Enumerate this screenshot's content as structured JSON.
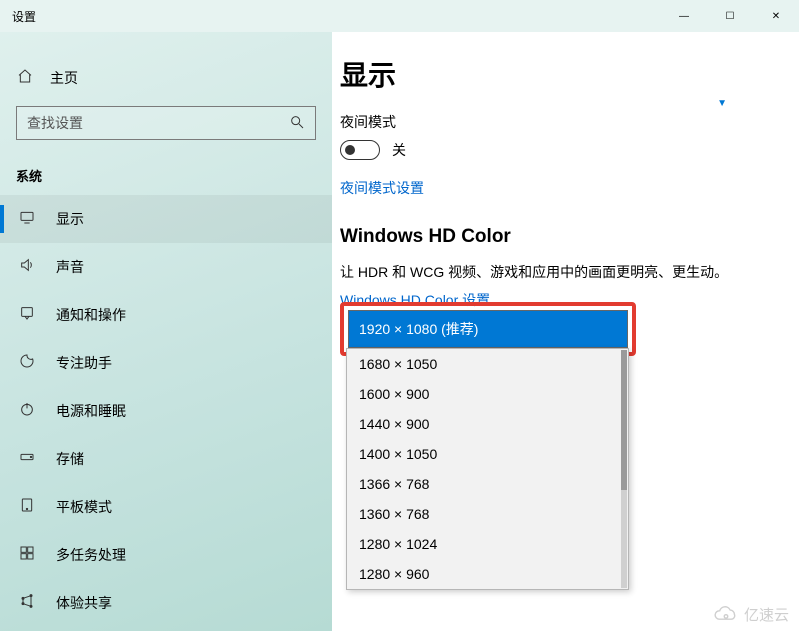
{
  "window": {
    "title": "设置",
    "minimize": "—",
    "maximize": "☐",
    "close": "✕"
  },
  "sidebar": {
    "home_label": "主页",
    "search_placeholder": "查找设置",
    "group_label": "系统",
    "items": [
      {
        "icon": "display",
        "label": "显示",
        "selected": true
      },
      {
        "icon": "sound",
        "label": "声音"
      },
      {
        "icon": "notify",
        "label": "通知和操作"
      },
      {
        "icon": "focus",
        "label": "专注助手"
      },
      {
        "icon": "power",
        "label": "电源和睡眠"
      },
      {
        "icon": "storage",
        "label": "存储"
      },
      {
        "icon": "tablet",
        "label": "平板模式"
      },
      {
        "icon": "multitask",
        "label": "多任务处理"
      },
      {
        "icon": "share",
        "label": "体验共享"
      }
    ]
  },
  "main": {
    "page_title": "显示",
    "night_mode_label": "夜间模式",
    "night_mode_state": "关",
    "night_mode_link": "夜间模式设置",
    "hd_title": "Windows HD Color",
    "hd_desc": "让 HDR 和 WCG 视频、游戏和应用中的画面更明亮、更生动。",
    "hd_link": "Windows HD Color 设置",
    "resolution_selected": "1920 × 1080 (推荐)",
    "resolution_options": [
      "1680 × 1050",
      "1600 × 900",
      "1440 × 900",
      "1400 × 1050",
      "1366 × 768",
      "1360 × 768",
      "1280 × 1024",
      "1280 × 960"
    ]
  },
  "watermark": "亿速云"
}
